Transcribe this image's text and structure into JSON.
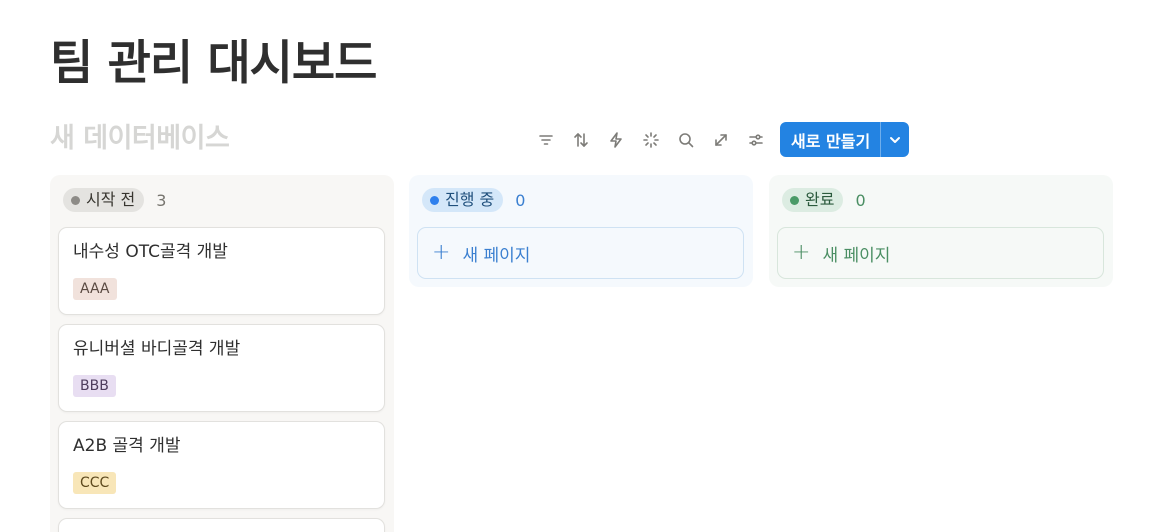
{
  "page": {
    "title": "팀 관리 대시보드"
  },
  "database": {
    "title": "새 데이터베이스"
  },
  "toolbar": {
    "icons": [
      "filter-icon",
      "sort-icon",
      "automation-icon",
      "ai-sparkle-icon",
      "search-icon",
      "expand-icon",
      "settings-icon"
    ],
    "new_label": "새로 만들기"
  },
  "columns": {
    "todo": {
      "status": "시작 전",
      "count": "3",
      "cards": [
        {
          "title": "내수성 OTC골격 개발",
          "tag": "AAA"
        },
        {
          "title": "유니버셜 바디골격 개발",
          "tag": "BBB"
        },
        {
          "title": "A2B 골격 개발",
          "tag": "CCC"
        }
      ]
    },
    "progress": {
      "status": "진행 중",
      "count": "0",
      "add_label": "새 페이지"
    },
    "done": {
      "status": "완료",
      "count": "0",
      "add_label": "새 페이지"
    }
  },
  "colors": {
    "accent": "#2383e2",
    "status_todo": "#8d8b87",
    "status_progress": "#2f80ed",
    "status_done": "#4a9a68"
  }
}
